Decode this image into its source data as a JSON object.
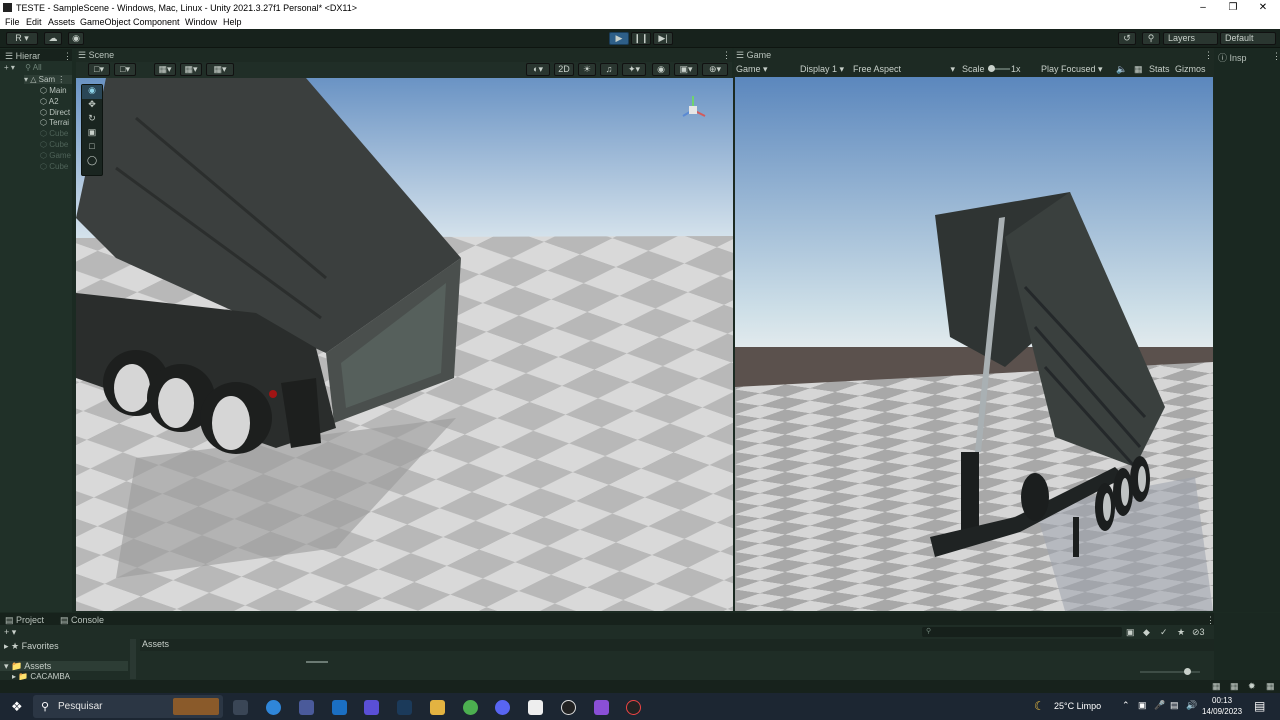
{
  "window": {
    "title": "TESTE - SampleScene - Windows, Mac, Linux - Unity 2021.3.27f1 Personal* <DX11>"
  },
  "menu": [
    "File",
    "Edit",
    "Assets",
    "GameObject",
    "Component",
    "Window",
    "Help"
  ],
  "toolbar": {
    "account_label": "R",
    "layers_label": "Layers",
    "layout_label": "Default"
  },
  "hierarchy": {
    "tab_label": "Hierar",
    "search_label": "All",
    "scene_name": "Sam",
    "items": [
      {
        "label": "Main",
        "dim": false
      },
      {
        "label": "A2",
        "dim": false
      },
      {
        "label": "Direct",
        "dim": false
      },
      {
        "label": "Terrai",
        "dim": false
      },
      {
        "label": "Cube",
        "dim": true
      },
      {
        "label": "Cube",
        "dim": true
      },
      {
        "label": "Game",
        "dim": true
      },
      {
        "label": "Cube",
        "dim": true
      }
    ]
  },
  "scene": {
    "tab_label": "Scene",
    "mode_2d": "2D"
  },
  "game": {
    "tab_label": "Game",
    "view_select": "Game",
    "display_select": "Display 1",
    "aspect_select": "Free Aspect",
    "scale_label": "Scale",
    "scale_value": "1x",
    "play_mode_select": "Play Focused",
    "stats_label": "Stats",
    "gizmos_label": "Gizmos"
  },
  "inspector": {
    "tab_label": "Insp"
  },
  "project": {
    "tab_project": "Project",
    "tab_console": "Console",
    "favorites_label": "Favorites",
    "assets_label": "Assets",
    "assets_header": "Assets",
    "folder_item": "CACAMBA",
    "hidden_count": "3"
  },
  "taskbar": {
    "search_placeholder": "Pesquisar",
    "weather": "25°C  Limpo",
    "time": "00:13",
    "date": "14/09/2023"
  },
  "colors": {
    "unity_bg": "#233029",
    "play_accent": "#2e5f88",
    "sky_top": "#5b87bd",
    "sky_horizon": "#cfe0e8",
    "truck_body": "#3b3f3e"
  }
}
